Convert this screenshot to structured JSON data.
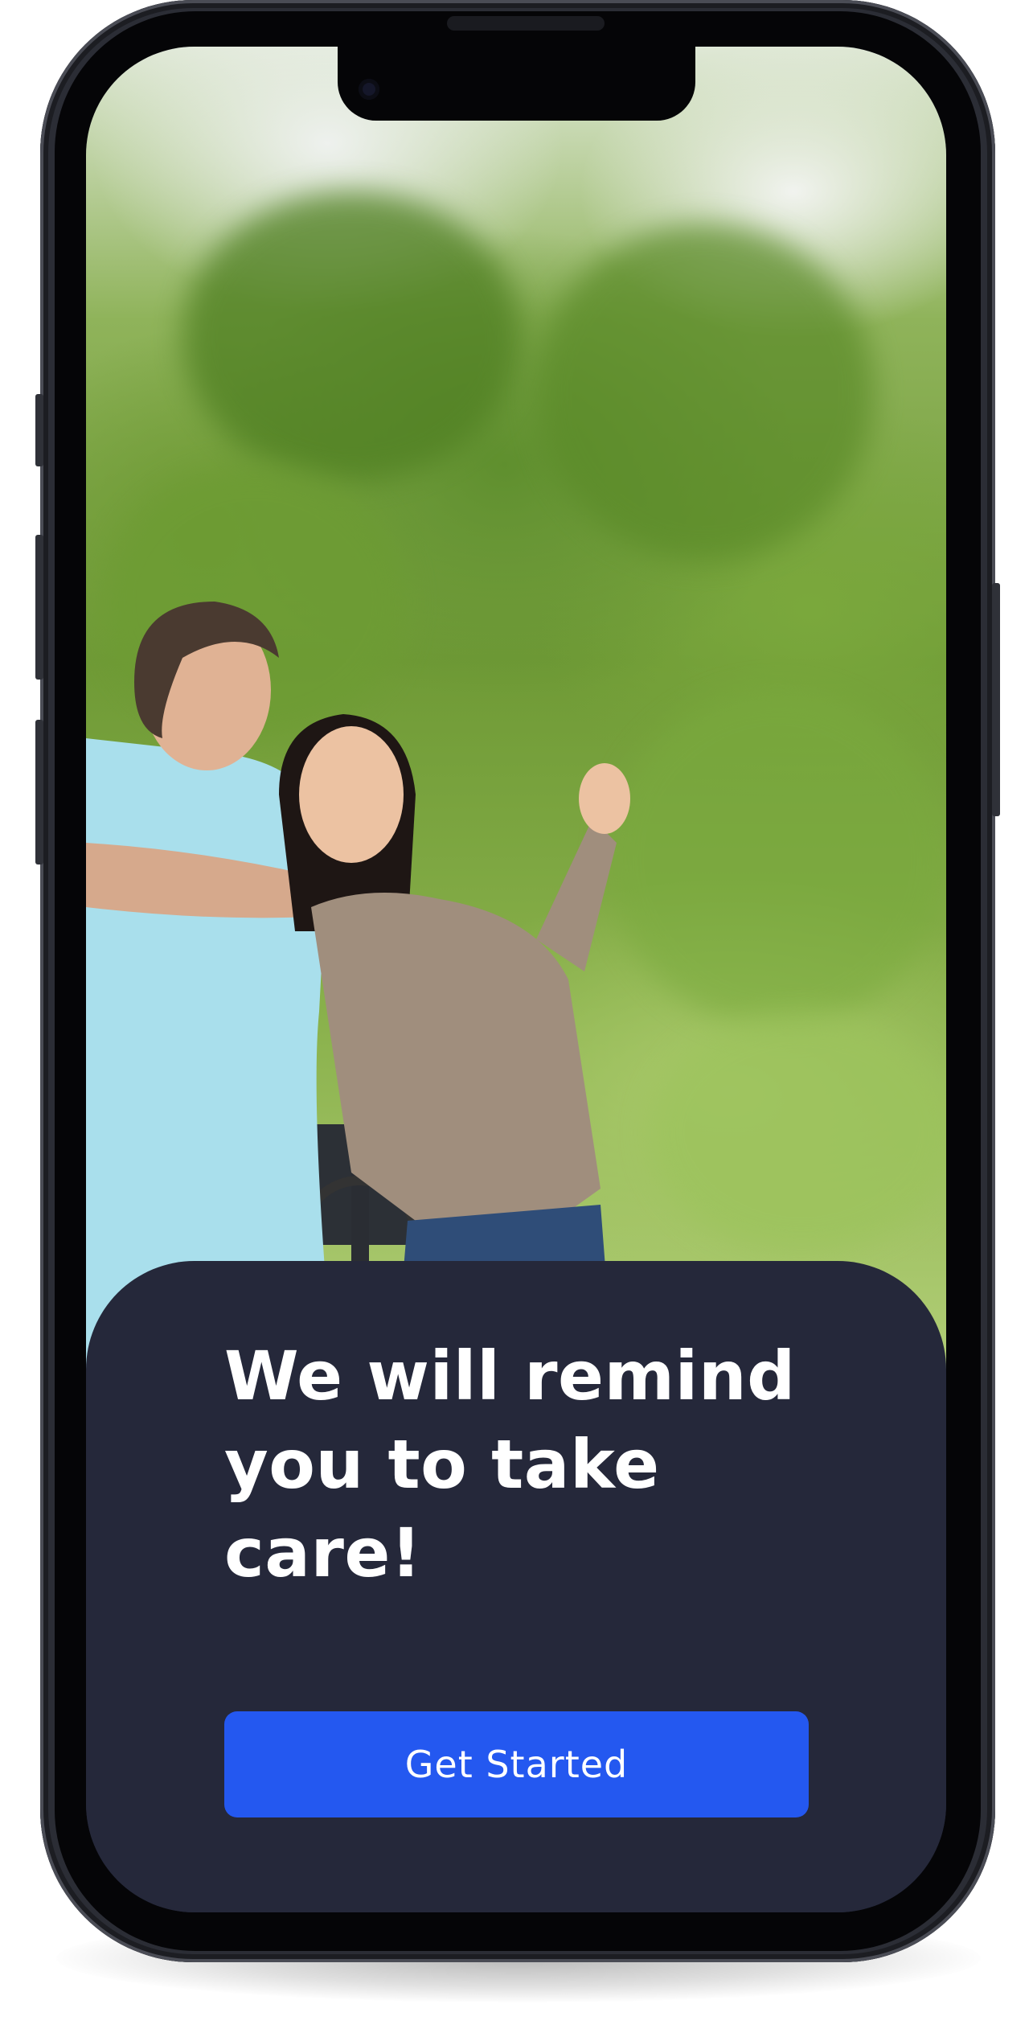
{
  "onboarding": {
    "photo_description_alt": "Caregiver and elderly patient outdoors",
    "headline": "We will remind you to take care!",
    "cta_label": "Get Started"
  },
  "colors": {
    "card_background": "#25283a",
    "button_primary": "#2458f0",
    "headline_text": "#ffffff"
  },
  "icons": [
    "front-camera-icon"
  ]
}
